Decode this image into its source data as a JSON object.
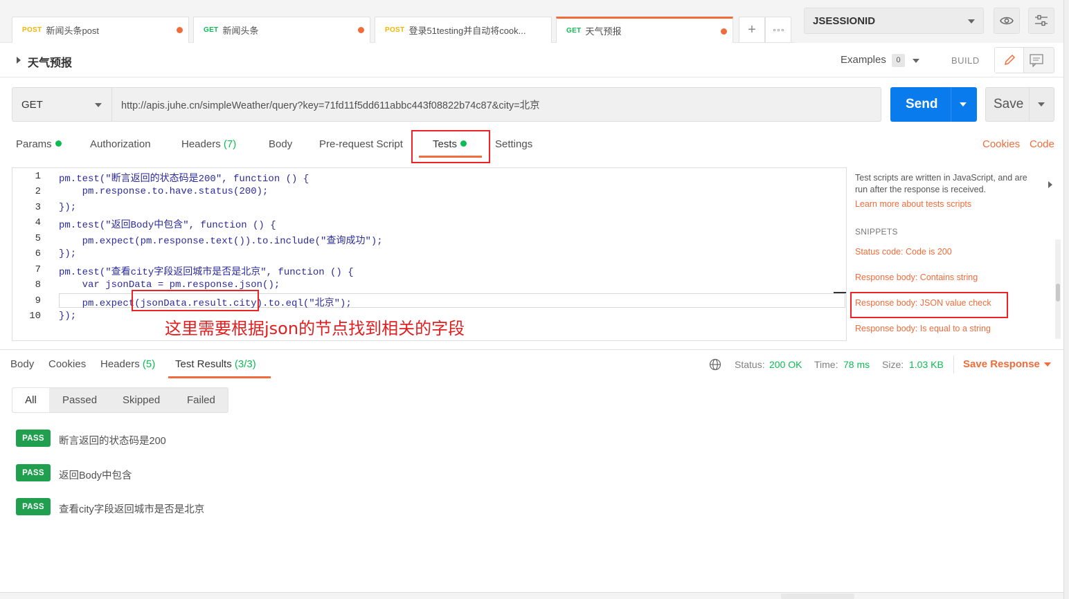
{
  "tabs": [
    {
      "method": "POST",
      "name": "新闻头条post"
    },
    {
      "method": "GET",
      "name": "新闻头条"
    },
    {
      "method": "POST",
      "name": "登录51testing并自动将cook..."
    },
    {
      "method": "GET",
      "name": "天气预报"
    }
  ],
  "tab_actions": {
    "add": "+",
    "more": "∘∘∘"
  },
  "environment": {
    "selected": "JSESSIONID"
  },
  "request": {
    "title": "天气预报",
    "examples_label": "Examples",
    "examples_count": "0",
    "build_label": "BUILD",
    "method": "GET",
    "url": "http://apis.juhe.cn/simpleWeather/query?key=71fd11f5dd611abbc443f08822b74c87&city=北京",
    "send_label": "Send",
    "save_label": "Save"
  },
  "request_tabs": {
    "params": "Params",
    "authorization": "Authorization",
    "headers": "Headers",
    "headers_count": "(7)",
    "body": "Body",
    "prerequest": "Pre-request Script",
    "tests": "Tests",
    "settings": "Settings",
    "cookies": "Cookies",
    "code": "Code"
  },
  "editor": {
    "line_numbers": [
      "1",
      "2",
      "3",
      "4",
      "5",
      "6",
      "7",
      "8",
      "9",
      "10"
    ],
    "lines": [
      "pm.test(\"断言返回的状态码是200\", function () {",
      "    pm.response.to.have.status(200);",
      "});",
      "pm.test(\"返回Body中包含\", function () {",
      "    pm.expect(pm.response.text()).to.include(\"查询成功\");",
      "});",
      "pm.test(\"查看city字段返回城市是否是北京\", function () {",
      "    var jsonData = pm.response.json();",
      "    pm.expect(jsonData.result.city).to.eql(\"北京\");",
      "});"
    ],
    "annotation": "这里需要根据json的节点找到相关的字段"
  },
  "sidebar": {
    "intro_line1": "Test scripts are written in JavaScript, and are",
    "intro_line2": "run after the response is received.",
    "learn_more": "Learn more about tests scripts",
    "snippets_heading": "SNIPPETS",
    "snippets": [
      "Status code: Code is 200",
      "Response body: Contains string",
      "Response body: JSON value check",
      "Response body: Is equal to a string"
    ]
  },
  "response": {
    "tabs": {
      "body": "Body",
      "cookies": "Cookies",
      "headers": "Headers",
      "headers_count": "(5)",
      "test_results": "Test Results",
      "test_results_count": "(3/3)"
    },
    "status_label": "Status:",
    "status_value": "200 OK",
    "time_label": "Time:",
    "time_value": "78 ms",
    "size_label": "Size:",
    "size_value": "1.03 KB",
    "save_response": "Save Response",
    "filters": [
      "All",
      "Passed",
      "Skipped",
      "Failed"
    ],
    "results": [
      {
        "status": "PASS",
        "name": "断言返回的状态码是200"
      },
      {
        "status": "PASS",
        "name": "返回Body中包含"
      },
      {
        "status": "PASS",
        "name": "查看city字段返回城市是否是北京"
      }
    ]
  },
  "colors": {
    "accent": "#f26b3a",
    "send": "#097bed",
    "pass": "#20a04f",
    "success": "#0cbb52",
    "highlight": "#e22222"
  }
}
